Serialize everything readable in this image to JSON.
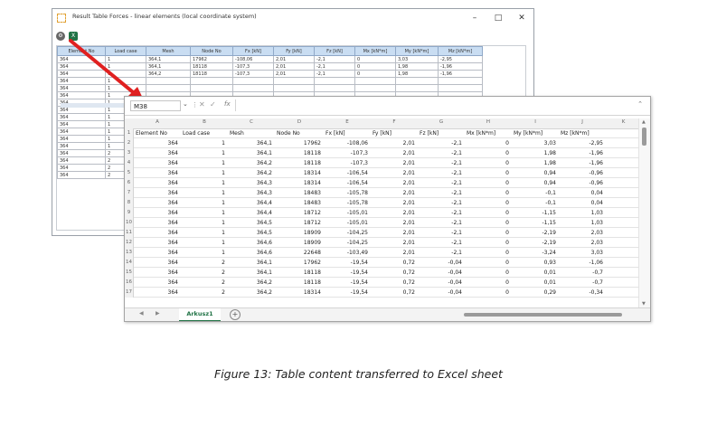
{
  "app": {
    "title": "Result Table Forces - linear elements (local coordinate system)",
    "columns": [
      "Element No",
      "Load case",
      "Mesh",
      "Node No",
      "Fx [kN]",
      "Fy [kN]",
      "Fz [kN]",
      "Mx [kN*m]",
      "My [kN*m]",
      "Mz [kN*m]"
    ],
    "rows": [
      [
        "364",
        "1",
        "364,1",
        "17962",
        "-108,06",
        "2,01",
        "-2,1",
        "0",
        "3,03",
        "-2,95"
      ],
      [
        "364",
        "1",
        "364,1",
        "18118",
        "-107,3",
        "2,01",
        "-2,1",
        "0",
        "1,98",
        "-1,96"
      ],
      [
        "364",
        "1",
        "364,2",
        "18118",
        "-107,3",
        "2,01",
        "-2,1",
        "0",
        "1,98",
        "-1,96"
      ]
    ],
    "partial_rows": [
      [
        "364",
        "1"
      ],
      [
        "364",
        "1"
      ],
      [
        "364",
        "1"
      ],
      [
        "364",
        "1"
      ],
      [
        "364",
        "1"
      ],
      [
        "364",
        "1"
      ],
      [
        "364",
        "1"
      ],
      [
        "364",
        "1"
      ],
      [
        "364",
        "1"
      ],
      [
        "364",
        "1"
      ],
      [
        "364",
        "2"
      ],
      [
        "364",
        "2"
      ],
      [
        "364",
        "2"
      ],
      [
        "364",
        "2"
      ]
    ]
  },
  "excel": {
    "name_box": "M38",
    "fx_label": "fx",
    "col_letters": [
      "A",
      "B",
      "C",
      "D",
      "E",
      "F",
      "G",
      "H",
      "I",
      "J",
      "K"
    ],
    "headers": [
      "Element No",
      "Load case",
      "Mesh",
      "Node No",
      "Fx [kN]",
      "Fy [kN]",
      "Fz [kN]",
      "Mx [kN*m]",
      "My [kN*m]",
      "Mz [kN*m]"
    ],
    "rows": [
      [
        "364",
        "1",
        "364,1",
        "17962",
        "-108,06",
        "2,01",
        "-2,1",
        "0",
        "3,03",
        "-2,95"
      ],
      [
        "364",
        "1",
        "364,1",
        "18118",
        "-107,3",
        "2,01",
        "-2,1",
        "0",
        "1,98",
        "-1,96"
      ],
      [
        "364",
        "1",
        "364,2",
        "18118",
        "-107,3",
        "2,01",
        "-2,1",
        "0",
        "1,98",
        "-1,96"
      ],
      [
        "364",
        "1",
        "364,2",
        "18314",
        "-106,54",
        "2,01",
        "-2,1",
        "0",
        "0,94",
        "-0,96"
      ],
      [
        "364",
        "1",
        "364,3",
        "18314",
        "-106,54",
        "2,01",
        "-2,1",
        "0",
        "0,94",
        "-0,96"
      ],
      [
        "364",
        "1",
        "364,3",
        "18483",
        "-105,78",
        "2,01",
        "-2,1",
        "0",
        "-0,1",
        "0,04"
      ],
      [
        "364",
        "1",
        "364,4",
        "18483",
        "-105,78",
        "2,01",
        "-2,1",
        "0",
        "-0,1",
        "0,04"
      ],
      [
        "364",
        "1",
        "364,4",
        "18712",
        "-105,01",
        "2,01",
        "-2,1",
        "0",
        "-1,15",
        "1,03"
      ],
      [
        "364",
        "1",
        "364,5",
        "18712",
        "-105,01",
        "2,01",
        "-2,1",
        "0",
        "-1,15",
        "1,03"
      ],
      [
        "364",
        "1",
        "364,5",
        "18909",
        "-104,25",
        "2,01",
        "-2,1",
        "0",
        "-2,19",
        "2,03"
      ],
      [
        "364",
        "1",
        "364,6",
        "18909",
        "-104,25",
        "2,01",
        "-2,1",
        "0",
        "-2,19",
        "2,03"
      ],
      [
        "364",
        "1",
        "364,6",
        "22648",
        "-103,49",
        "2,01",
        "-2,1",
        "0",
        "-3,24",
        "3,03"
      ],
      [
        "364",
        "2",
        "364,1",
        "17962",
        "-19,54",
        "0,72",
        "-0,04",
        "0",
        "0,93",
        "-1,06"
      ],
      [
        "364",
        "2",
        "364,1",
        "18118",
        "-19,54",
        "0,72",
        "-0,04",
        "0",
        "0,01",
        "-0,7"
      ],
      [
        "364",
        "2",
        "364,2",
        "18118",
        "-19,54",
        "0,72",
        "-0,04",
        "0",
        "0,01",
        "-0,7"
      ],
      [
        "364",
        "2",
        "364,2",
        "18314",
        "-19,54",
        "0,72",
        "-0,04",
        "0",
        "0,29",
        "-0,34"
      ]
    ],
    "sheet_tab": "Arkusz1"
  },
  "caption": "Figure 13:  Table content transferred to Excel sheet",
  "colors": {
    "arrow": "#e02020",
    "excel_green": "#217346",
    "header_blue": "#c9ddf2"
  }
}
